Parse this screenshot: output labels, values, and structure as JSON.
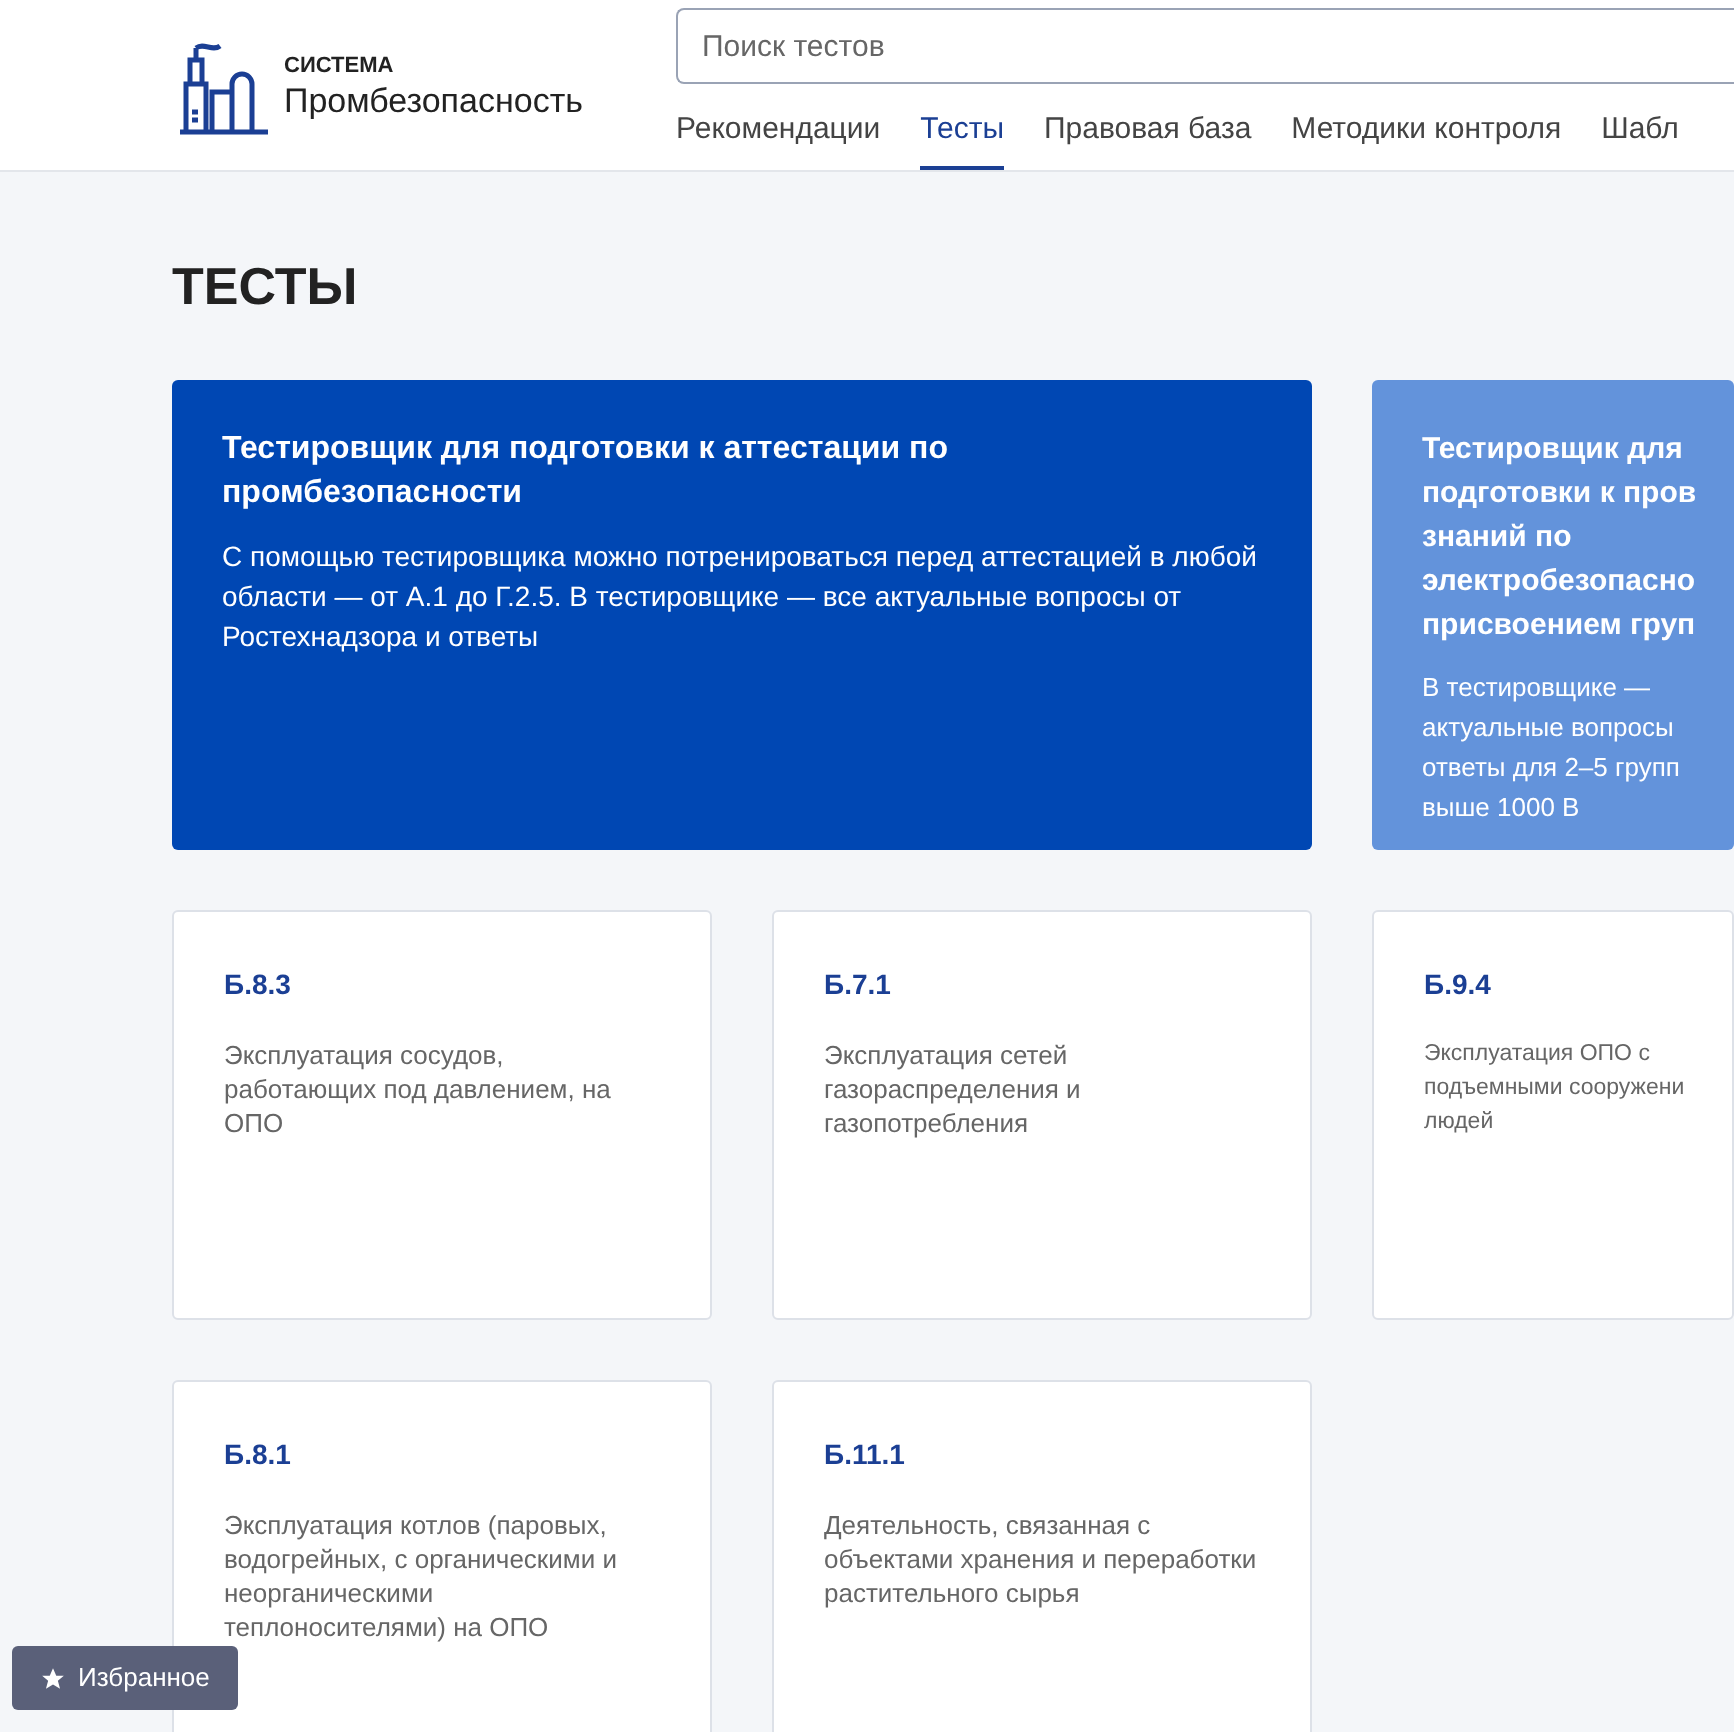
{
  "header": {
    "logo": {
      "small": "СИСТЕМА",
      "name": "Промбезопасность"
    },
    "search": {
      "placeholder": "Поиск тестов"
    },
    "nav": [
      {
        "label": "Рекомендации",
        "selected": false
      },
      {
        "label": "Тесты",
        "selected": true
      },
      {
        "label": "Правовая база",
        "selected": false
      },
      {
        "label": "Методики контроля",
        "selected": false
      },
      {
        "label": "Шабл",
        "selected": false
      }
    ]
  },
  "page_title": "ТЕСТЫ",
  "promos": [
    {
      "title": "Тестировщик для подготовки к аттестации по промбезопасности",
      "description": "С помощью тестировщика можно потренироваться перед аттестацией в любой области — от А.1 до Г.2.5. В тестировщике — все актуальные вопросы от Ростехнадзора и ответы",
      "color": "#0047b3"
    },
    {
      "title_lines": [
        "Тестировщик для",
        "подготовки к пров",
        "знаний по",
        "электробезопасно",
        "присвоением груп"
      ],
      "description_lines": [
        "В тестировщике —",
        "актуальные вопросы",
        "ответы для 2–5 групп",
        "выше 1000 В"
      ],
      "color": "#6393db"
    }
  ],
  "tests": [
    {
      "code": "Б.8.3",
      "description": "Эксплуатация сосудов, работающих под давлением, на ОПО"
    },
    {
      "code": "Б.7.1",
      "description": "Эксплуатация сетей газораспределения и газопотребления"
    },
    {
      "code": "Б.9.4",
      "description_lines": [
        "Эксплуатация ОПО с",
        "подъемными сооружени",
        "людей"
      ]
    },
    {
      "code": "Б.8.1",
      "description": "Эксплуатация котлов (паровых, водогрейных, с органическими и неорганическими теплоносителями) на ОПО"
    },
    {
      "code": "Б.11.1",
      "description": "Деятельность, связанная с объектами хранения и переработки растительного сырья"
    }
  ],
  "favorites_button": {
    "label": "Избранное"
  }
}
